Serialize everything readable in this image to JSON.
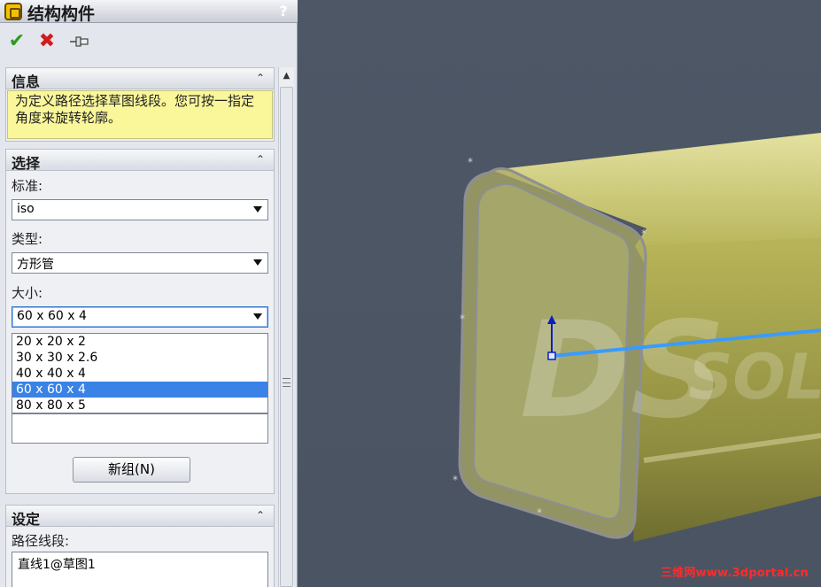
{
  "window": {
    "title": "结构构件",
    "help": "?"
  },
  "actions": {
    "ok": "✔",
    "cancel": "✖",
    "pin": "⊣▭"
  },
  "info": {
    "title": "信息",
    "text": "为定义路径选择草图线段。您可按一指定角度来旋转轮廓。"
  },
  "selection": {
    "title": "选择",
    "standard": {
      "label": "标准:",
      "value": "iso"
    },
    "type": {
      "label": "类型:",
      "value": "方形管"
    },
    "size": {
      "label": "大小:",
      "value": "60 x 60 x 4",
      "options": [
        "20 x 20 x 2",
        "30 x 30 x 2.6",
        "40 x 40 x 4",
        "60 x 60 x 4",
        "80 x 80 x 5"
      ],
      "selected_index": 3
    },
    "new_group_button": "新组(N)"
  },
  "settings": {
    "title": "设定",
    "path_label": "路径线段:",
    "path_items": [
      "直线1@草图1"
    ]
  },
  "icons": {
    "title": "structure-member-icon",
    "collapse": "double-chevron-up-icon",
    "combo": "caret-down-icon"
  },
  "viewport": {
    "watermark": "三维网www.3dportal.cn",
    "logo_text": "DS SOL"
  },
  "colors": {
    "info_box": "#f9f79a",
    "tube": "#c9c66a",
    "path_line": "#3a9bff",
    "selection": "#3b82e6"
  }
}
